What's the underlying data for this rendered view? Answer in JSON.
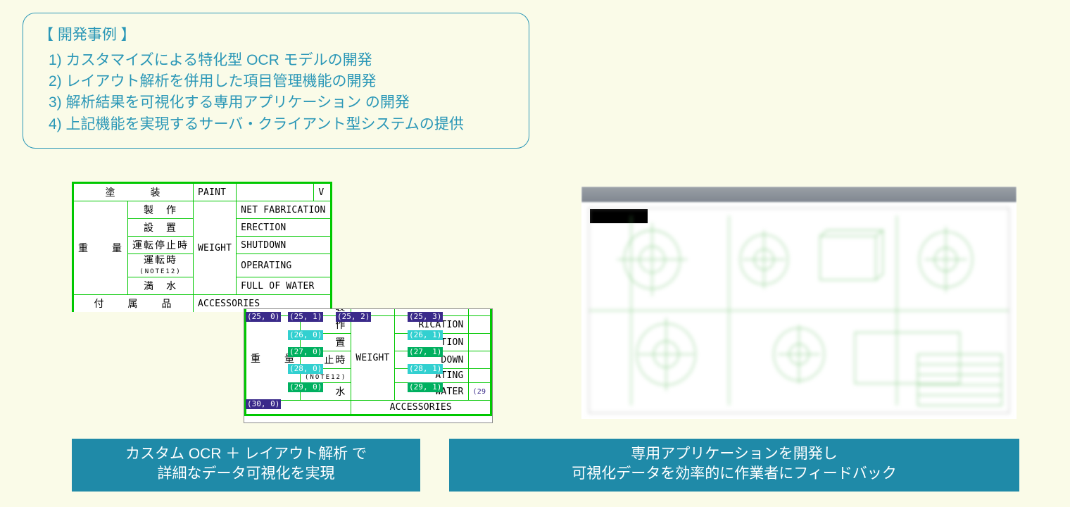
{
  "caseBox": {
    "title": "【 開発事例 】",
    "items": [
      "1) カスタマイズによる特化型 OCR モデルの開発",
      "2) レイアウト解析を併用した項目管理機能の開発",
      "3) 解析結果を可視化する専用アプリケーション の開発",
      "4) 上記機能を実現するサーバ・クライアント型システムの提供"
    ]
  },
  "leftTable": {
    "top": {
      "jp": "塗　　　装",
      "en": "PAINT",
      "extra": "V"
    },
    "rowGroup": {
      "jp": "重　　量",
      "en": "WEIGHT"
    },
    "rows": [
      {
        "jp": "製　作",
        "en": "NET FABRICATION"
      },
      {
        "jp": "設　置",
        "en": "ERECTION"
      },
      {
        "jp": "運転停止時",
        "en": "SHUTDOWN"
      },
      {
        "jp": "運転時",
        "note": "(NOTE12)",
        "en": "OPERATING"
      },
      {
        "jp": "満　水",
        "en": "FULL OF WATER"
      }
    ],
    "bottom": {
      "jp": "付　　属　　品",
      "en": "ACCESSORIES"
    }
  },
  "overlayTable": {
    "topCoord": "(25, 0)",
    "header": {
      "jp": "装",
      "coords": [
        "(25, 1)",
        "(25, 2)",
        "(25, 3)"
      ]
    },
    "rowGroup": {
      "jp": "重　　量",
      "en": "WEIGHT"
    },
    "rows": [
      {
        "c1": "(25, 1)",
        "jp": "作",
        "en": "RICATION",
        "c2": "(25, 3)"
      },
      {
        "c1": "(26, 0)",
        "jp": "置",
        "en": "TION",
        "c2": "(26, 1)"
      },
      {
        "c1": "(27, 0)",
        "jp": "止時",
        "en": "DOWN",
        "c2": "(27, 1)"
      },
      {
        "c1": "(28, 0)",
        "jp": "",
        "note": "(NOTE12)",
        "en": "ATING",
        "c2": "(28, 1)"
      },
      {
        "c1": "(29, 0)",
        "jp": "水",
        "en": "WATER",
        "c2": "(29, 1)",
        "extra": "(29"
      }
    ],
    "bottom": {
      "c1": "(30, 0)",
      "en": "ACCESSORIES"
    }
  },
  "captions": {
    "left": "カスタム OCR ＋ レイアウト解析 で\n詳細なデータ可視化を実現",
    "right": "専用アプリケーションを開発し\n可視化データを効率的に作業者にフィードバック"
  }
}
